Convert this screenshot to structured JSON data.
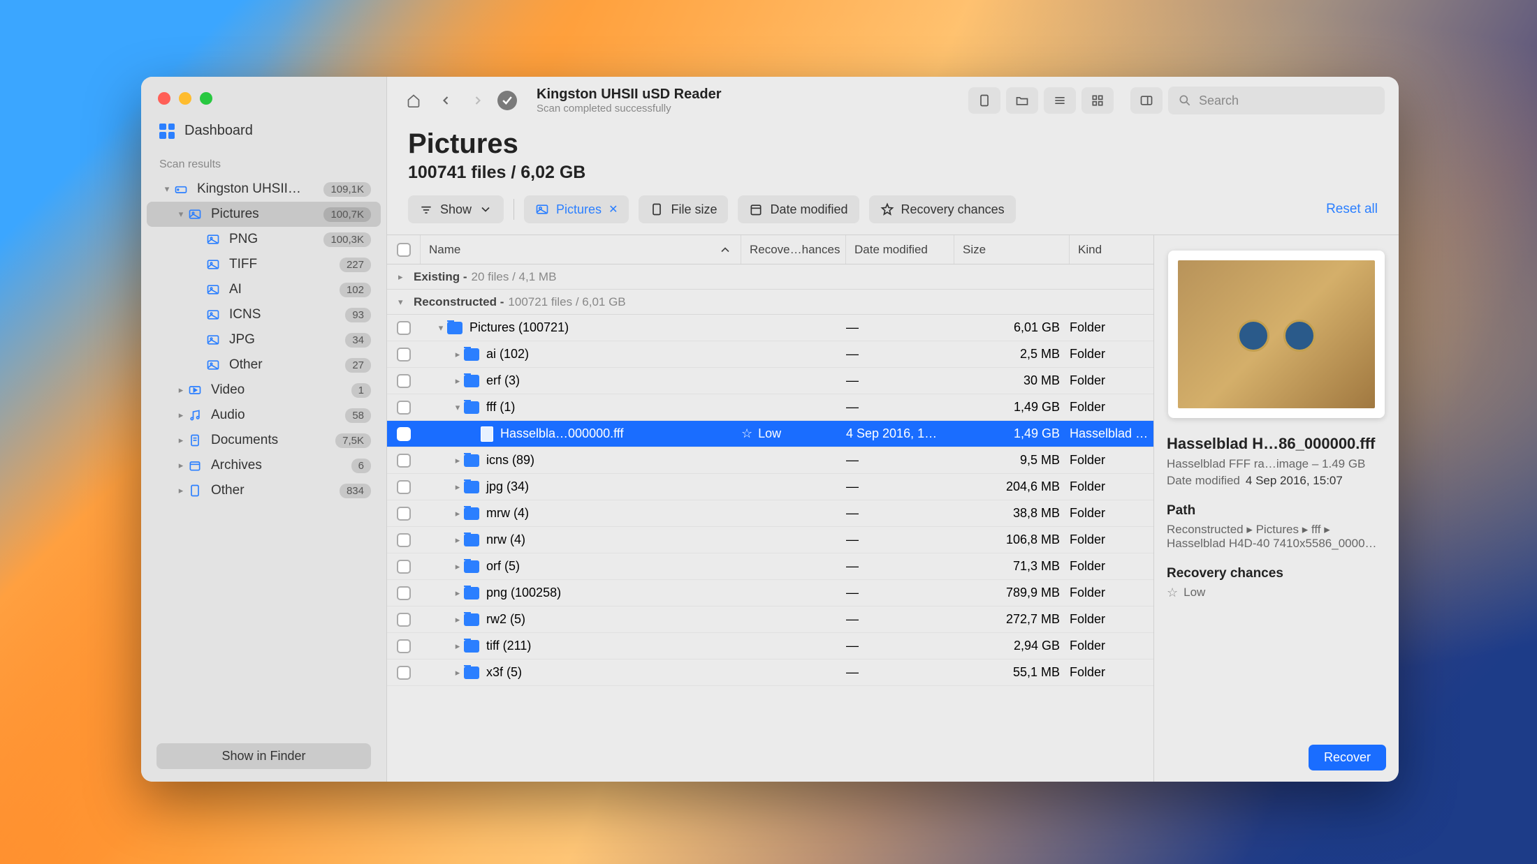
{
  "sidebar": {
    "dashboard": "Dashboard",
    "scan_results_label": "Scan results",
    "show_in_finder": "Show in Finder",
    "items": [
      {
        "label": "Kingston UHSII…",
        "count": "109,1K",
        "icon": "drive",
        "chevron": "down",
        "depth": 0
      },
      {
        "label": "Pictures",
        "count": "100,7K",
        "icon": "image",
        "chevron": "down",
        "depth": 1,
        "selected": true
      },
      {
        "label": "PNG",
        "count": "100,3K",
        "icon": "image",
        "depth": 2
      },
      {
        "label": "TIFF",
        "count": "227",
        "icon": "image",
        "depth": 2
      },
      {
        "label": "AI",
        "count": "102",
        "icon": "image",
        "depth": 2
      },
      {
        "label": "ICNS",
        "count": "93",
        "icon": "image",
        "depth": 2
      },
      {
        "label": "JPG",
        "count": "34",
        "icon": "image",
        "depth": 2
      },
      {
        "label": "Other",
        "count": "27",
        "icon": "image",
        "depth": 2
      },
      {
        "label": "Video",
        "count": "1",
        "icon": "video",
        "chevron": "right",
        "depth": 1
      },
      {
        "label": "Audio",
        "count": "58",
        "icon": "audio",
        "chevron": "right",
        "depth": 1
      },
      {
        "label": "Documents",
        "count": "7,5K",
        "icon": "doc",
        "chevron": "right",
        "depth": 1
      },
      {
        "label": "Archives",
        "count": "6",
        "icon": "archive",
        "chevron": "right",
        "depth": 1
      },
      {
        "label": "Other",
        "count": "834",
        "icon": "other",
        "chevron": "right",
        "depth": 1
      }
    ]
  },
  "toolbar": {
    "title": "Kingston UHSII uSD Reader",
    "subtitle": "Scan completed successfully",
    "search_placeholder": "Search"
  },
  "heading": {
    "title": "Pictures",
    "sub": "100741 files / 6,02 GB"
  },
  "filters": {
    "show": "Show",
    "pictures": "Pictures",
    "file_size": "File size",
    "date_modified": "Date modified",
    "recovery_chances": "Recovery chances",
    "reset": "Reset all"
  },
  "columns": {
    "name": "Name",
    "recovery": "Recove…hances",
    "date_modified": "Date modified",
    "size": "Size",
    "kind": "Kind"
  },
  "groups": [
    {
      "name": "Existing",
      "stats": "20 files / 4,1 MB",
      "open": false
    },
    {
      "name": "Reconstructed",
      "stats": "100721 files / 6,01 GB",
      "open": true
    }
  ],
  "rows": [
    {
      "name": "Pictures (100721)",
      "indent": 0,
      "chev": "down",
      "type": "folder",
      "rec": "",
      "dm": "—",
      "size": "6,01 GB",
      "kind": "Folder"
    },
    {
      "name": "ai (102)",
      "indent": 1,
      "chev": "right",
      "type": "folder",
      "rec": "",
      "dm": "—",
      "size": "2,5 MB",
      "kind": "Folder"
    },
    {
      "name": "erf (3)",
      "indent": 1,
      "chev": "right",
      "type": "folder",
      "rec": "",
      "dm": "—",
      "size": "30 MB",
      "kind": "Folder"
    },
    {
      "name": "fff (1)",
      "indent": 1,
      "chev": "down",
      "type": "folder",
      "rec": "",
      "dm": "—",
      "size": "1,49 GB",
      "kind": "Folder"
    },
    {
      "name": "Hasselbla…000000.fff",
      "indent": 2,
      "chev": "",
      "type": "file",
      "rec": "Low",
      "dm": "4 Sep 2016, 1…",
      "size": "1,49 GB",
      "kind": "Hasselblad F…",
      "selected": true
    },
    {
      "name": "icns (89)",
      "indent": 1,
      "chev": "right",
      "type": "folder",
      "rec": "",
      "dm": "—",
      "size": "9,5 MB",
      "kind": "Folder"
    },
    {
      "name": "jpg (34)",
      "indent": 1,
      "chev": "right",
      "type": "folder",
      "rec": "",
      "dm": "—",
      "size": "204,6 MB",
      "kind": "Folder"
    },
    {
      "name": "mrw (4)",
      "indent": 1,
      "chev": "right",
      "type": "folder",
      "rec": "",
      "dm": "—",
      "size": "38,8 MB",
      "kind": "Folder"
    },
    {
      "name": "nrw (4)",
      "indent": 1,
      "chev": "right",
      "type": "folder",
      "rec": "",
      "dm": "—",
      "size": "106,8 MB",
      "kind": "Folder"
    },
    {
      "name": "orf (5)",
      "indent": 1,
      "chev": "right",
      "type": "folder",
      "rec": "",
      "dm": "—",
      "size": "71,3 MB",
      "kind": "Folder"
    },
    {
      "name": "png (100258)",
      "indent": 1,
      "chev": "right",
      "type": "folder",
      "rec": "",
      "dm": "—",
      "size": "789,9 MB",
      "kind": "Folder"
    },
    {
      "name": "rw2 (5)",
      "indent": 1,
      "chev": "right",
      "type": "folder",
      "rec": "",
      "dm": "—",
      "size": "272,7 MB",
      "kind": "Folder"
    },
    {
      "name": "tiff (211)",
      "indent": 1,
      "chev": "right",
      "type": "folder",
      "rec": "",
      "dm": "—",
      "size": "2,94 GB",
      "kind": "Folder"
    },
    {
      "name": "x3f (5)",
      "indent": 1,
      "chev": "right",
      "type": "folder",
      "rec": "",
      "dm": "—",
      "size": "55,1 MB",
      "kind": "Folder"
    }
  ],
  "preview": {
    "title": "Hasselblad H…86_000000.fff",
    "sub": "Hasselblad FFF ra…image – 1.49 GB",
    "date_label": "Date modified",
    "date_value": "4 Sep 2016, 15:07",
    "path_label": "Path",
    "path_value": "Reconstructed ▸ Pictures ▸ fff ▸ Hasselblad H4D-40 7410x5586_0000…",
    "recovery_label": "Recovery chances",
    "recovery_value": "Low",
    "recover_btn": "Recover"
  }
}
